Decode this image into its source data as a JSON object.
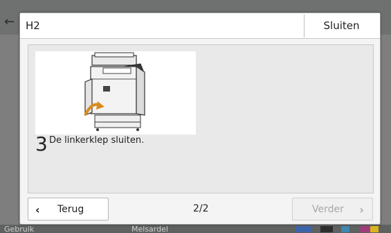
{
  "background": {
    "status_left": "Gebruik",
    "status_center": "Melsardel"
  },
  "dialog": {
    "title": "H2",
    "close_label": "Sluiten",
    "step": {
      "number": "3",
      "text": "De linkerklep sluiten."
    },
    "nav": {
      "back_label": "Terug",
      "next_label": "Verder",
      "page_indicator": "2/2",
      "back_icon": "chevron-left-icon",
      "next_icon": "chevron-right-icon"
    }
  },
  "colors": {
    "overlay": "#6f7170",
    "dialog_bg": "#f4f4f4",
    "accent_arrow": "#d98c1e",
    "disabled_text": "#a7a7a7"
  }
}
